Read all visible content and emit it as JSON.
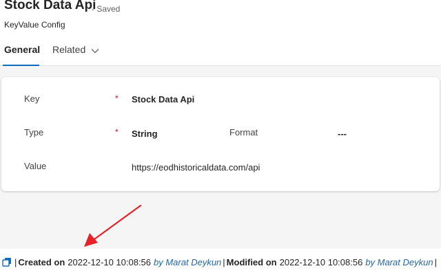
{
  "header": {
    "title": "Stock Data Api",
    "save_status": "- Saved",
    "entity": "KeyValue Config"
  },
  "tabs": [
    {
      "label": "General",
      "active": true
    },
    {
      "label": "Related",
      "active": false,
      "icon": "chevron-down-icon"
    }
  ],
  "form": {
    "key_label": "Key",
    "key_value": "Stock Data Api",
    "type_label": "Type",
    "type_value": "String",
    "format_label": "Format",
    "format_value": "---",
    "value_label": "Value",
    "value_value": "https://eodhistoricaldata.com/api",
    "required_marker": "*"
  },
  "footer": {
    "icon": "copy-icon",
    "created_label": "Created on",
    "created_datetime": "2022-12-10 10:08:56",
    "created_by": "by Marat Deykun",
    "modified_label": "Modified on",
    "modified_datetime": "2022-12-10 10:08:56",
    "modified_by": "by Marat Deykun",
    "separator": "|",
    "close_symbol": "×"
  },
  "colors": {
    "accent": "#0f6cbd",
    "required": "#c50f1f",
    "annotation_arrow": "#e8202a",
    "link": "#2266aa"
  }
}
